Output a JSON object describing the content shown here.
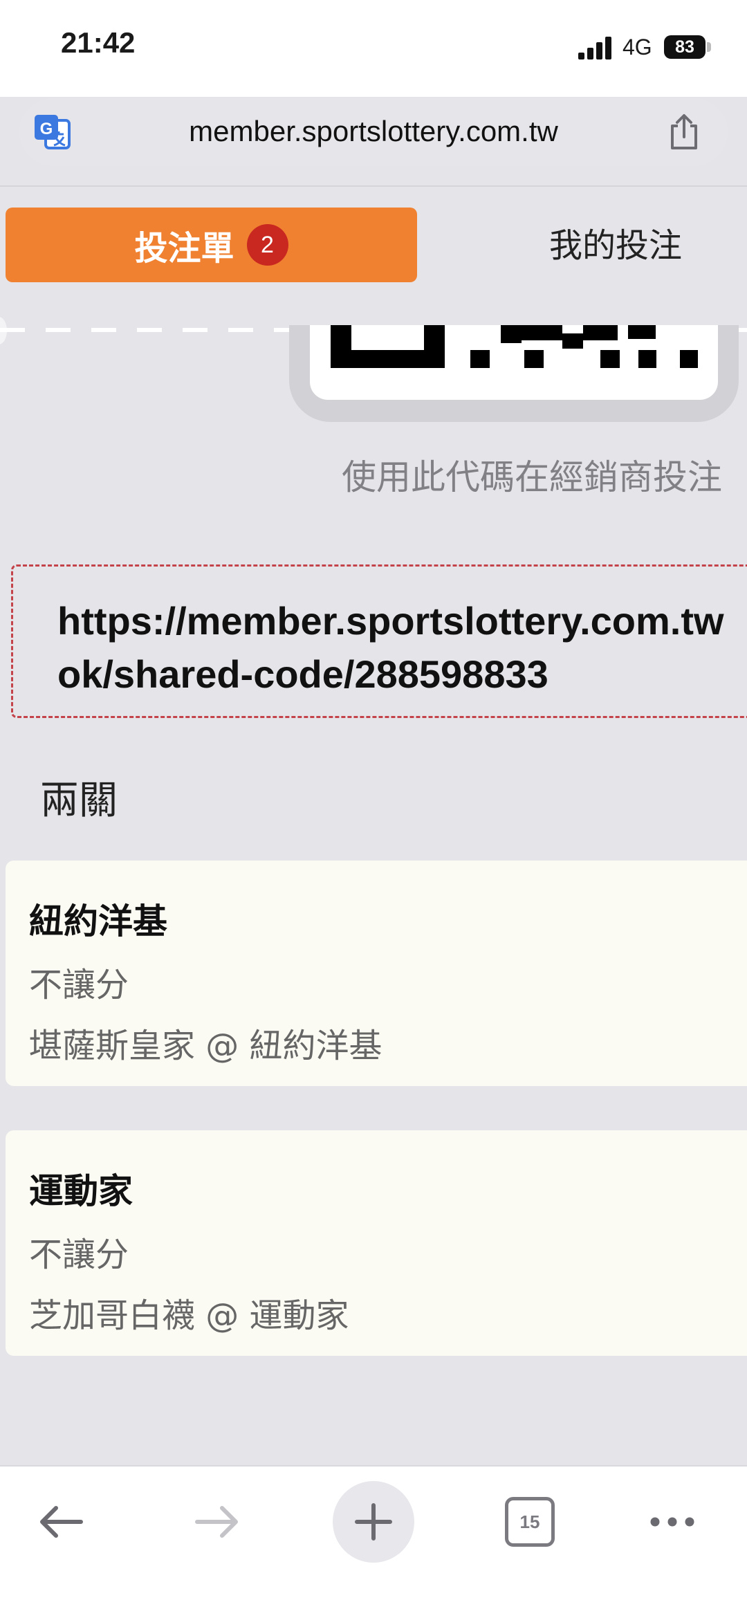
{
  "status_bar": {
    "time": "21:42",
    "network": "4G",
    "battery": "83"
  },
  "browser": {
    "url": "member.sportslottery.com.tw"
  },
  "tabs": {
    "bet_slip_label": "投注單",
    "bet_slip_count": "2",
    "my_bets_label": "我的投注"
  },
  "share_code": {
    "helper_text": "使用此代碼在經銷商投注",
    "link_line1": "https://member.sportslottery.com.tw",
    "link_line2": "ok/shared-code/288598833"
  },
  "parlay": {
    "title": "兩關"
  },
  "bets": [
    {
      "team": "紐約洋基",
      "market": "不讓分",
      "match": "堪薩斯皇家 @ 紐約洋基"
    },
    {
      "team": "運動家",
      "market": "不讓分",
      "match": "芝加哥白襪 @ 運動家"
    }
  ],
  "bottom_toolbar": {
    "tab_count": "15"
  },
  "colors": {
    "accent": "#f08131",
    "badge": "#c8281f",
    "link_border": "#c4434b",
    "card_bg": "#fbfbf3",
    "page_bg": "#e5e5e9"
  },
  "icons": [
    "translate-icon",
    "share-icon",
    "back-arrow-icon",
    "forward-arrow-icon",
    "plus-icon",
    "tabs-icon",
    "more-icon"
  ]
}
